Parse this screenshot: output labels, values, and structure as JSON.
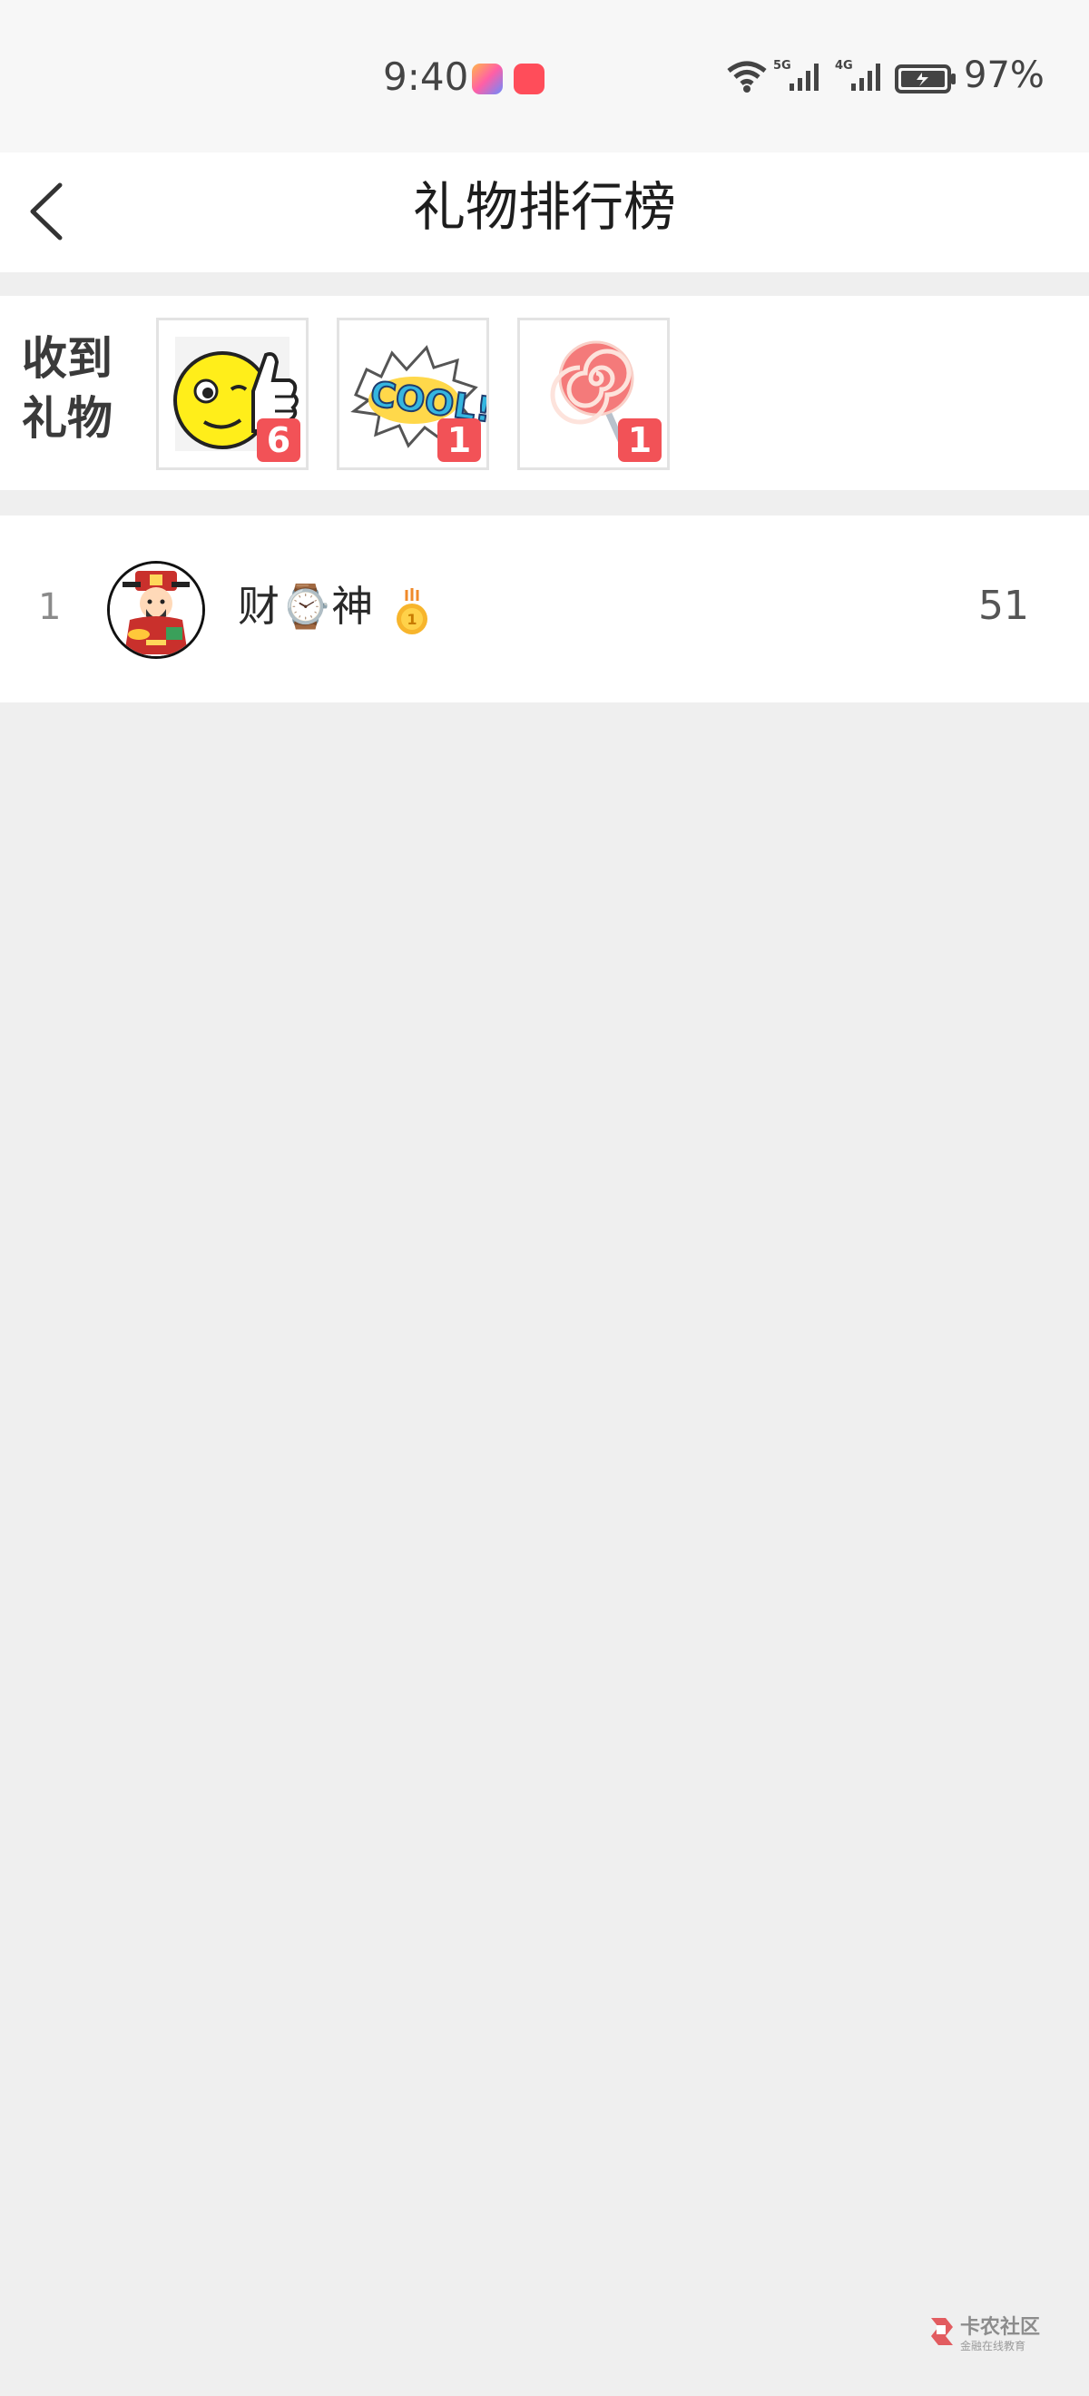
{
  "status_bar": {
    "time": "9:40",
    "battery_percent": "97%",
    "network_1": "5G",
    "network_2": "4G",
    "icons": [
      "wifi-icon",
      "signal-5g-icon",
      "signal-4g-icon",
      "battery-icon"
    ]
  },
  "header": {
    "title": "礼物排行榜",
    "back_icon": "chevron-left-icon"
  },
  "gifts": {
    "label": "收到礼物",
    "items": [
      {
        "name": "thumbs-up-emoji",
        "count": "6"
      },
      {
        "name": "cool-sticker",
        "count": "1"
      },
      {
        "name": "lollipop",
        "count": "1"
      }
    ]
  },
  "ranking": {
    "rows": [
      {
        "rank": "1",
        "name": "财⌚神",
        "medal": "1",
        "score": "51"
      }
    ]
  },
  "watermark": {
    "title": "卡农社区",
    "subtitle": "金融在线教育"
  },
  "colors": {
    "badge": "#f25257",
    "background": "#efefef",
    "card": "#ffffff"
  }
}
